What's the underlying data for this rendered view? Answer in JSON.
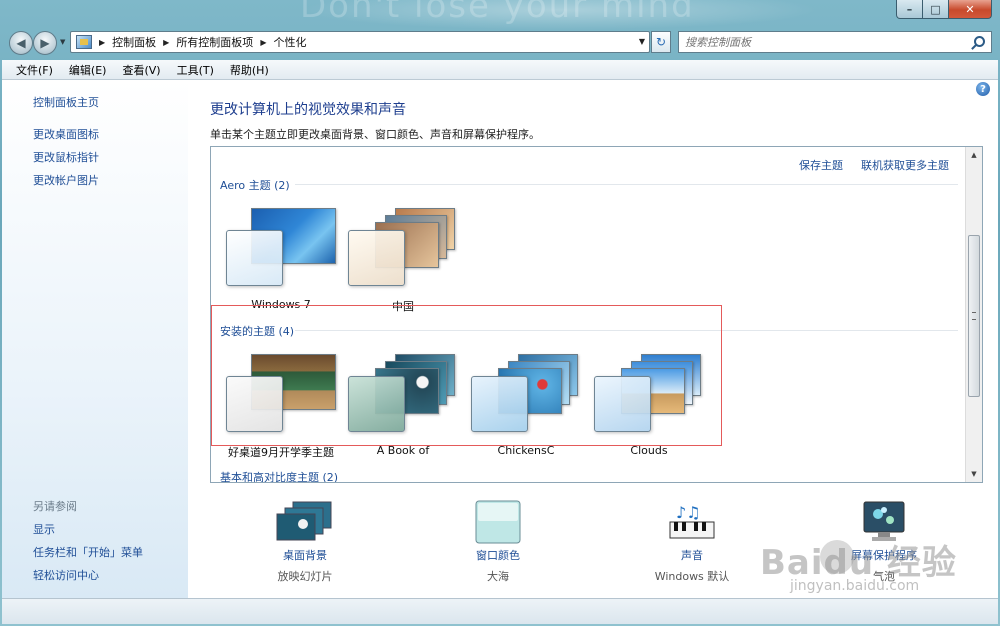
{
  "window": {
    "watermark_text": "Don't lose your mind",
    "caption": {
      "min": "–",
      "max": "□",
      "close": "✕"
    }
  },
  "address": {
    "crumbs": [
      "控制面板",
      "所有控制面板项",
      "个性化"
    ],
    "search_placeholder": "搜索控制面板"
  },
  "menu": [
    "文件(F)",
    "编辑(E)",
    "查看(V)",
    "工具(T)",
    "帮助(H)"
  ],
  "sidebar": {
    "home": "控制面板主页",
    "links": [
      "更改桌面图标",
      "更改鼠标指针",
      "更改帐户图片"
    ],
    "see_also_title": "另请参阅",
    "see_also": [
      "显示",
      "任务栏和「开始」菜单",
      "轻松访问中心"
    ]
  },
  "main": {
    "title": "更改计算机上的视觉效果和声音",
    "subtitle": "单击某个主题立即更改桌面背景、窗口颜色、声音和屏幕保护程序。",
    "help_icon": "?"
  },
  "panel": {
    "save_theme": "保存主题",
    "get_more": "联机获取更多主题",
    "groups": [
      {
        "title": "Aero 主题 (2)",
        "themes": [
          "Windows 7",
          "中国"
        ]
      },
      {
        "title": "安装的主题 (4)",
        "themes": [
          "好桌道9月开学季主题",
          "A Book of",
          "ChickensC",
          "Clouds"
        ]
      },
      {
        "title": "基本和高对比度主题 (2)"
      }
    ]
  },
  "bottom": [
    {
      "label": "桌面背景",
      "sub": "放映幻灯片",
      "icon": "desktop-background-icon"
    },
    {
      "label": "窗口颜色",
      "sub": "大海",
      "icon": "window-color-icon"
    },
    {
      "label": "声音",
      "sub": "Windows 默认",
      "icon": "sound-icon"
    },
    {
      "label": "屏幕保护程序",
      "sub": "气泡",
      "icon": "screensaver-icon"
    }
  ],
  "watermark": {
    "brand": "Baidu 经验",
    "url": "jingyan.baidu.com"
  }
}
